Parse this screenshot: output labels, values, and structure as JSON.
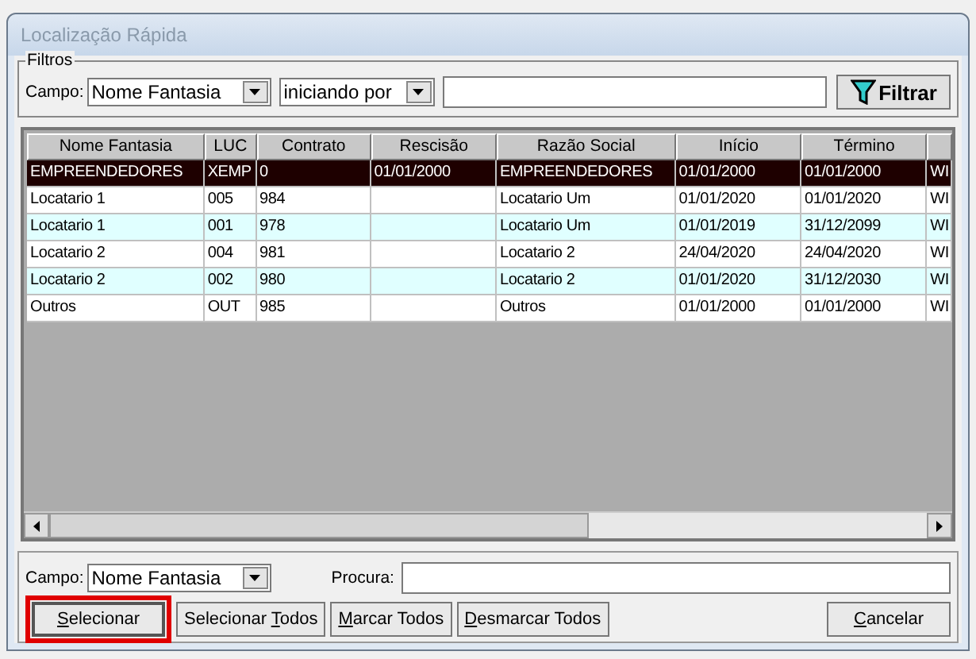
{
  "window": {
    "title": "Localização Rápida"
  },
  "filters": {
    "legend": "Filtros",
    "field_label": "Campo:",
    "field_value": "Nome Fantasia",
    "mode_value": "iniciando por",
    "button": "Filtrar"
  },
  "table": {
    "columns": [
      "Nome Fantasia",
      "LUC",
      "Contrato",
      "Rescisão",
      "Razão Social",
      "Início",
      "Término"
    ],
    "rows": [
      {
        "selected": true,
        "cells": [
          "EMPREENDEDORES",
          "XEMP",
          "0",
          "01/01/2000",
          "EMPREENDEDORES",
          "01/01/2000",
          "01/01/2000",
          "WI"
        ]
      },
      {
        "selected": false,
        "cells": [
          "Locatario 1",
          "005",
          "984",
          "",
          "Locatario Um",
          "01/01/2020",
          "01/01/2020",
          "WI"
        ]
      },
      {
        "selected": false,
        "cells": [
          "Locatario 1",
          "001",
          "978",
          "",
          "Locatario Um",
          "01/01/2019",
          "31/12/2099",
          "WI"
        ]
      },
      {
        "selected": false,
        "cells": [
          "Locatario 2",
          "004",
          "981",
          "",
          "Locatario 2",
          "24/04/2020",
          "24/04/2020",
          "WI"
        ]
      },
      {
        "selected": false,
        "cells": [
          "Locatario 2",
          "002",
          "980",
          "",
          "Locatario 2",
          "01/01/2020",
          "31/12/2030",
          "WI"
        ]
      },
      {
        "selected": false,
        "cells": [
          "Outros",
          "OUT",
          "985",
          "",
          "Outros",
          "01/01/2000",
          "01/01/2000",
          "WI"
        ]
      }
    ]
  },
  "search": {
    "field_label": "Campo:",
    "field_value": "Nome Fantasia",
    "search_label": "Procura:"
  },
  "buttons": [
    {
      "key": "S",
      "after": "elecionar",
      "highlighted": true
    },
    {
      "before": "Selecionar ",
      "key": "T",
      "after": "odos",
      "highlighted": false
    },
    {
      "key": "M",
      "after": "arcar Todos",
      "highlighted": false
    },
    {
      "key": "D",
      "after": "esmarcar Todos",
      "highlighted": false
    }
  ],
  "cancel": {
    "key": "C",
    "after": "ancelar"
  }
}
